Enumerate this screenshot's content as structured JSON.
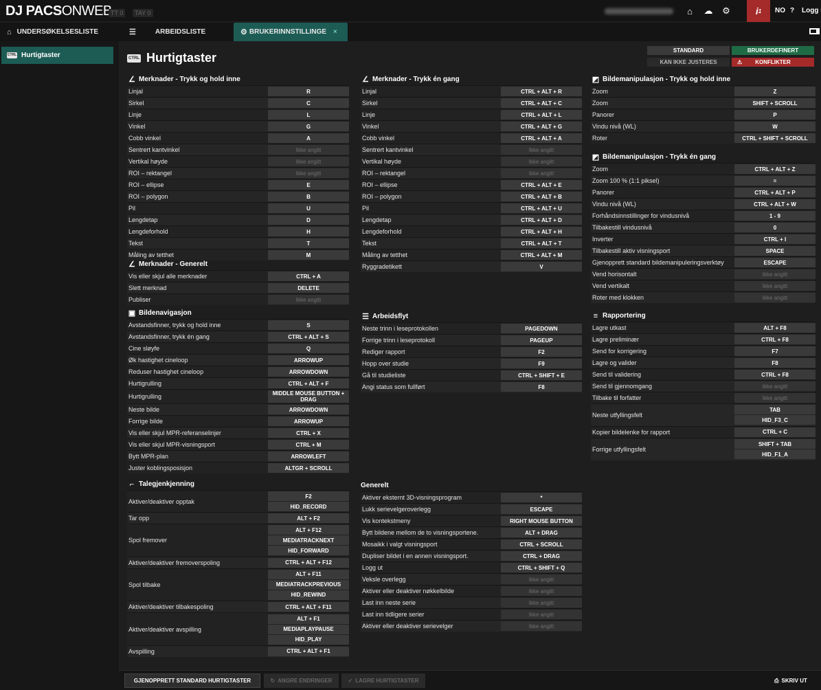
{
  "app": {
    "logo_bold": "DJ PACS",
    "logo_light": "ONWEB",
    "tag1": "TT 0",
    "tag2": "TAY 0",
    "info_count": "1",
    "lang": "NO",
    "help": "?",
    "logout": "Logg ut"
  },
  "tabs": [
    {
      "label": "UNDERSØKELSESLISTE",
      "icon": "home-icon"
    },
    {
      "label": "ARBEIDSLISTE",
      "icon": "list-icon"
    },
    {
      "label": "BRUKERINNSTILLINGER",
      "icon": "gear-icon"
    }
  ],
  "sidebar": {
    "items": [
      {
        "label": "Hurtigtaster",
        "icon": "keyboard-icon"
      }
    ]
  },
  "page": {
    "title": "Hurtigtaster"
  },
  "legend": {
    "standard": "STANDARD",
    "userdef": "BRUKERDEFINERT",
    "cannot": "KAN IKKE JUSTERES",
    "conflicts": "KONFLIKTER"
  },
  "colors": {
    "accent": "#1c5c55",
    "user_defined": "#1f6b45",
    "conflict": "#a52a2a",
    "key_bg": "#3a3a3a"
  },
  "sections": [
    {
      "title": "Merknader - Trykk og hold inne",
      "icon": "annotation-icon",
      "rows": [
        {
          "label": "Linjal",
          "keys": [
            "R"
          ]
        },
        {
          "label": "Sirkel",
          "keys": [
            "C"
          ]
        },
        {
          "label": "Linje",
          "keys": [
            "L"
          ]
        },
        {
          "label": "Vinkel",
          "keys": [
            "G"
          ]
        },
        {
          "label": "Cobb vinkel",
          "keys": [
            "A"
          ]
        },
        {
          "label": "Sentrert kantvinkel",
          "keys": [
            "Ikke angitt"
          ]
        },
        {
          "label": "Vertikal høyde",
          "keys": [
            "Ikke angitt"
          ]
        },
        {
          "label": "ROI – rektangel",
          "keys": [
            "Ikke angitt"
          ]
        },
        {
          "label": "ROI – ellipse",
          "keys": [
            "E"
          ]
        },
        {
          "label": "ROI – polygon",
          "keys": [
            "B"
          ]
        },
        {
          "label": "Pil",
          "keys": [
            "U"
          ]
        },
        {
          "label": "Lengdetap",
          "keys": [
            "D"
          ]
        },
        {
          "label": "Lengdeforhold",
          "keys": [
            "H"
          ]
        },
        {
          "label": "Tekst",
          "keys": [
            "T"
          ]
        },
        {
          "label": "Måling av tetthet",
          "keys": [
            "M"
          ]
        }
      ]
    },
    {
      "title": "Merknader - Generelt",
      "icon": "annotation-icon",
      "rows": [
        {
          "label": "Vis eller skjul alle merknader",
          "keys": [
            "CTRL + A"
          ]
        },
        {
          "label": "Slett merknad",
          "keys": [
            "DELETE"
          ]
        },
        {
          "label": "Publiser",
          "keys": [
            "Ikke angitt"
          ]
        }
      ]
    },
    {
      "title": "Bildenavigasjon",
      "icon": "image-nav-icon",
      "rows": [
        {
          "label": "Avstandsfinner, trykk og hold inne",
          "keys": [
            "S"
          ]
        },
        {
          "label": "Avstandsfinner, trykk én gang",
          "keys": [
            "CTRL + ALT + S"
          ]
        },
        {
          "label": "Cine sløyfe",
          "keys": [
            "Q"
          ]
        },
        {
          "label": "Øk hastighet cineloop",
          "keys": [
            "ARROWUP"
          ]
        },
        {
          "label": "Reduser hastighet cineloop",
          "keys": [
            "ARROWDOWN"
          ]
        },
        {
          "label": "Hurtigrulling",
          "keys": [
            "CTRL + ALT + F"
          ]
        },
        {
          "label": "Hurtigrulling",
          "keys": [
            "MIDDLE MOUSE BUTTON + DRAG"
          ]
        },
        {
          "label": "Neste bilde",
          "keys": [
            "ARROWDOWN"
          ]
        },
        {
          "label": "Forrige bilde",
          "keys": [
            "ARROWUP"
          ]
        },
        {
          "label": "Vis eller skjul MPR-referanselinjer",
          "keys": [
            "CTRL + X"
          ]
        },
        {
          "label": "Vis eller skjul MPR-visningsport",
          "keys": [
            "CTRL + M"
          ]
        },
        {
          "label": "Bytt MPR-plan",
          "keys": [
            "ARROWLEFT"
          ]
        },
        {
          "label": "Juster koblingsposisjon",
          "keys": [
            "ALTGR + SCROLL"
          ]
        }
      ]
    },
    {
      "title": "Talegjenkjenning",
      "icon": "microphone-icon",
      "rows": [
        {
          "label": "Aktiver/deaktiver opptak",
          "keys": [
            "F2",
            "HID_RECORD"
          ]
        },
        {
          "label": "Tar opp",
          "keys": [
            "ALT + F2"
          ]
        },
        {
          "label": "Spol fremover",
          "keys": [
            "ALT + F12",
            "MEDIATRACKNEXT",
            "HID_FORWARD"
          ]
        },
        {
          "label": "Aktiver/deaktiver fremoverspoling",
          "keys": [
            "CTRL + ALT + F12"
          ]
        },
        {
          "label": "Spol tilbake",
          "keys": [
            "ALT + F11",
            "MEDIATRACKPREVIOUS",
            "HID_REWIND"
          ]
        },
        {
          "label": "Aktiver/deaktiver tilbakespoling",
          "keys": [
            "CTRL + ALT + F11"
          ]
        },
        {
          "label": "Aktiver/deaktiver avspilling",
          "keys": [
            "ALT + F1",
            "MEDIAPLAYPAUSE",
            "HID_PLAY"
          ]
        },
        {
          "label": "Avspilling",
          "keys": [
            "CTRL + ALT + F1"
          ]
        }
      ]
    },
    {
      "title": "Merknader - Trykk én gang",
      "icon": "annotation-icon",
      "rows": [
        {
          "label": "Linjal",
          "keys": [
            "CTRL + ALT + R"
          ]
        },
        {
          "label": "Sirkel",
          "keys": [
            "CTRL + ALT + C"
          ]
        },
        {
          "label": "Linje",
          "keys": [
            "CTRL + ALT + L"
          ]
        },
        {
          "label": "Vinkel",
          "keys": [
            "CTRL + ALT + G"
          ]
        },
        {
          "label": "Cobb vinkel",
          "keys": [
            "CTRL + ALT + A"
          ]
        },
        {
          "label": "Sentrert kantvinkel",
          "keys": [
            "Ikke angitt"
          ]
        },
        {
          "label": "Vertikal høyde",
          "keys": [
            "Ikke angitt"
          ]
        },
        {
          "label": "ROI – rektangel",
          "keys": [
            "Ikke angitt"
          ]
        },
        {
          "label": "ROI – ellipse",
          "keys": [
            "CTRL + ALT + E"
          ]
        },
        {
          "label": "ROI – polygon",
          "keys": [
            "CTRL + ALT + B"
          ]
        },
        {
          "label": "Pil",
          "keys": [
            "CTRL + ALT + U"
          ]
        },
        {
          "label": "Lengdetap",
          "keys": [
            "CTRL + ALT + D"
          ]
        },
        {
          "label": "Lengdeforhold",
          "keys": [
            "CTRL + ALT + H"
          ]
        },
        {
          "label": "Tekst",
          "keys": [
            "CTRL + ALT + T"
          ]
        },
        {
          "label": "Måling av tetthet",
          "keys": [
            "CTRL + ALT + M"
          ]
        },
        {
          "label": "Ryggradetikett",
          "keys": [
            "V"
          ]
        }
      ]
    },
    {
      "title": "Arbeidsflyt",
      "icon": "list-icon",
      "rows": [
        {
          "label": "Neste trinn i leseprotokollen",
          "keys": [
            "PAGEDOWN"
          ]
        },
        {
          "label": "Forrige trinn i leseprotokoll",
          "keys": [
            "PAGEUP"
          ]
        },
        {
          "label": "Rediger rapport",
          "keys": [
            "F2"
          ]
        },
        {
          "label": "Hopp over studie",
          "keys": [
            "F9"
          ]
        },
        {
          "label": "Gå til studieliste",
          "keys": [
            "CTRL + SHIFT + E"
          ]
        },
        {
          "label": "Angi status som fullført",
          "keys": [
            "F8"
          ]
        }
      ]
    },
    {
      "title": "Generelt",
      "icon": "",
      "rows": [
        {
          "label": "Aktiver eksternt 3D-visningsprogram",
          "keys": [
            "*"
          ]
        },
        {
          "label": "Lukk serievelgeroverlegg",
          "keys": [
            "ESCAPE"
          ]
        },
        {
          "label": "Vis kontekstmeny",
          "keys": [
            "RIGHT MOUSE BUTTON"
          ]
        },
        {
          "label": "Bytt bildene mellom de to visningsportene.",
          "keys": [
            "ALT + DRAG"
          ]
        },
        {
          "label": "Mosaikk i valgt visningsport",
          "keys": [
            "CTRL + SCROLL"
          ]
        },
        {
          "label": "Dupliser bildet i en annen visningsport.",
          "keys": [
            "CTRL + DRAG"
          ]
        },
        {
          "label": "Logg ut",
          "keys": [
            "CTRL + SHIFT + Q"
          ]
        },
        {
          "label": "Veksle overlegg",
          "keys": [
            "Ikke angitt"
          ]
        },
        {
          "label": "Aktiver eller deaktiver nøkkelbilde",
          "keys": [
            "Ikke angitt"
          ]
        },
        {
          "label": "Last inn neste serie",
          "keys": [
            "Ikke angitt"
          ]
        },
        {
          "label": "Last inn tidligere serier",
          "keys": [
            "Ikke angitt"
          ]
        },
        {
          "label": "Aktiver eller deaktiver serievelger",
          "keys": [
            "Ikke angitt"
          ]
        }
      ]
    },
    {
      "title": "Bildemanipulasjon - Trykk og hold inne",
      "icon": "image-manip-icon",
      "rows": [
        {
          "label": "Zoom",
          "keys": [
            "Z"
          ]
        },
        {
          "label": "Zoom",
          "keys": [
            "SHIFT + SCROLL"
          ]
        },
        {
          "label": "Panorer",
          "keys": [
            "P"
          ]
        },
        {
          "label": "Vindu nivå (WL)",
          "keys": [
            "W"
          ]
        },
        {
          "label": "Roter",
          "keys": [
            "CTRL + SHIFT + SCROLL"
          ]
        }
      ]
    },
    {
      "title": "Bildemanipulasjon - Trykk én gang",
      "icon": "image-manip-icon",
      "rows": [
        {
          "label": "Zoom",
          "keys": [
            "CTRL + ALT + Z"
          ]
        },
        {
          "label": "Zoom 100 % (1:1 piksel)",
          "keys": [
            "="
          ]
        },
        {
          "label": "Panorer",
          "keys": [
            "CTRL + ALT + P"
          ]
        },
        {
          "label": "Vindu nivå (WL)",
          "keys": [
            "CTRL + ALT + W"
          ]
        },
        {
          "label": "Forhåndsinnstillinger for vindusnivå",
          "keys": [
            "1 - 9"
          ]
        },
        {
          "label": "Tilbakestill vindusnivå",
          "keys": [
            "0"
          ]
        },
        {
          "label": "Inverter",
          "keys": [
            "CTRL + I"
          ]
        },
        {
          "label": "Tilbakestill aktiv visningsport",
          "keys": [
            "SPACE"
          ]
        },
        {
          "label": "Gjenopprett standard bildemanipuleringsverktøy",
          "keys": [
            "ESCAPE"
          ]
        },
        {
          "label": "Vend horisontalt",
          "keys": [
            "Ikke angitt"
          ]
        },
        {
          "label": "Vend vertikalt",
          "keys": [
            "Ikke angitt"
          ]
        },
        {
          "label": "Roter med klokken",
          "keys": [
            "Ikke angitt"
          ]
        }
      ]
    },
    {
      "title": "Rapportering",
      "icon": "report-icon",
      "rows": [
        {
          "label": "Lagre utkast",
          "keys": [
            "ALT + F8"
          ]
        },
        {
          "label": "Lagre preliminær",
          "keys": [
            "CTRL + F8"
          ]
        },
        {
          "label": "Send for korrigering",
          "keys": [
            "F7"
          ]
        },
        {
          "label": "Lagre og valider",
          "keys": [
            "F8"
          ]
        },
        {
          "label": "Send til validering",
          "keys": [
            "CTRL + F8"
          ]
        },
        {
          "label": "Send til gjennomgang",
          "keys": [
            "Ikke angitt"
          ]
        },
        {
          "label": "Tilbake til forfatter",
          "keys": [
            "Ikke angitt"
          ]
        },
        {
          "label": "Neste utfyllingsfelt",
          "keys": [
            "TAB",
            "HID_F3_C"
          ]
        },
        {
          "label": "Kopier bildelenke for rapport",
          "keys": [
            "CTRL + C"
          ]
        },
        {
          "label": "Forrige utfyllingsfelt",
          "keys": [
            "SHIFT + TAB",
            "HID_F1_A"
          ]
        }
      ]
    }
  ],
  "bottom": {
    "restore": "GJENOPPRETT STANDARD HURTIGTASTER",
    "undo": "ANGRE ENDRINGER",
    "save": "LAGRE HURTIGTASTER",
    "print": "SKRIV UT"
  }
}
